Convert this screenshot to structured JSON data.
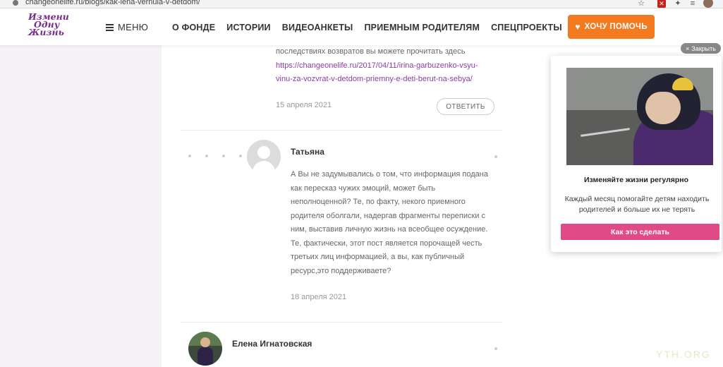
{
  "browser": {
    "url": "changeonelife.ru/blogs/kak-lena-vernula-v-detdom/"
  },
  "header": {
    "logo_lines": [
      "Измени",
      "Одну",
      "Жизнь"
    ],
    "menu_label": "МЕНЮ",
    "nav": [
      "О ФОНДЕ",
      "ИСТОРИИ",
      "ВИДЕОАНКЕТЫ",
      "ПРИЕМНЫМ РОДИТЕЛЯМ",
      "СПЕЦПРОЕКТЫ"
    ],
    "help_button": "ХОЧУ ПОМОЧЬ",
    "accent_color": "#f47a1f"
  },
  "comments": {
    "prev": {
      "text_line1": "последствиях возвратов вы можете прочитать здесь",
      "link_lines": [
        "https://changeonelife.ru/2017/04/11/irina-garbuzenko-vsyu-",
        "vinu-za-vozvrat-v-detdom-priemny-e-deti-berut-na-sebya/"
      ],
      "date": "15 апреля 2021",
      "reply": "ОТВЕТИТЬ"
    },
    "tatiana": {
      "author": "Татьяна",
      "lines": [
        "А Вы не задумывались о том, что информация подана",
        "как пересказ чужих эмоций, может быть",
        "неполноценной? Те, по факту, некого приемного",
        "родителя оболгали, надергав фрагменты переписки с",
        "ним, выставив личную жизнь на всеобщее осуждение.",
        "Те, фактически, этот пост является порочащей честь",
        "третьих лиц информацией, а вы, как публичный",
        "ресурс,это поддерживаете?"
      ],
      "date": "18 апреля 2021"
    },
    "elena": {
      "author": "Елена Игнатовская"
    }
  },
  "popup": {
    "close_label": "Закрыть",
    "title": "Изменяйте жизни регулярно",
    "text_lines": [
      "Каждый месяц помогайте детям находить",
      "родителей и больше их не терять"
    ],
    "button": "Как это сделать",
    "button_color": "#e04a86"
  },
  "watermark": "YTH.ORG"
}
